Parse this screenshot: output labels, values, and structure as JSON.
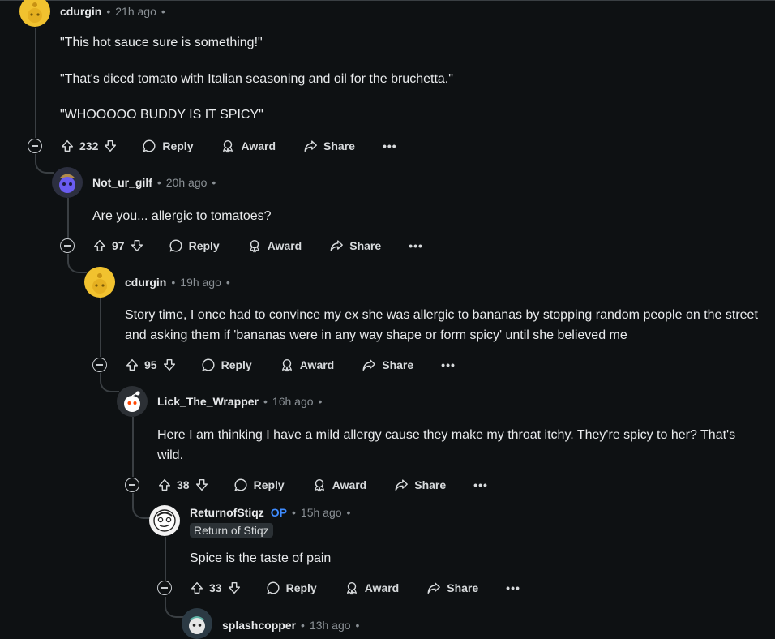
{
  "comments": [
    {
      "username": "cdurgin",
      "time": "21h ago",
      "paragraphs": [
        "\"This hot sauce sure is something!\"",
        "\"That's diced tomato with Italian seasoning and oil for the bruchetta.\"",
        "\"WHOOOOO BUDDY IS IT SPICY\""
      ],
      "votes": "232",
      "avatar": "snoo-avatar-yellow"
    },
    {
      "username": "Not_ur_gilf",
      "time": "20h ago",
      "paragraphs": [
        "Are you... allergic to tomatoes?"
      ],
      "votes": "97",
      "avatar": "snoo-avatar-purple"
    },
    {
      "username": "cdurgin",
      "time": "19h ago",
      "paragraphs": [
        "Story time, I once had to convince my ex she was allergic to bananas by stopping random people on the street and asking them if 'bananas were in any way shape or form spicy' until she believed me"
      ],
      "votes": "95",
      "avatar": "snoo-avatar-yellow"
    },
    {
      "username": "Lick_The_Wrapper",
      "time": "16h ago",
      "paragraphs": [
        "Here I am thinking I have a mild allergy cause they make my throat itchy. They're spicy to her? That's wild."
      ],
      "votes": "38",
      "avatar": "snoo-avatar-white"
    },
    {
      "username": "ReturnofStiqz",
      "op": "OP",
      "flair": "Return of Stiqz",
      "time": "15h ago",
      "paragraphs": [
        "Spice is the taste of pain"
      ],
      "votes": "33",
      "avatar": "sketch-avatar"
    },
    {
      "username": "splashcopper",
      "time": "13h ago",
      "avatar": "snoo-avatar-teal"
    }
  ],
  "actions": {
    "reply": "Reply",
    "award": "Award",
    "share": "Share",
    "more": "•••"
  },
  "separator": "•",
  "colors": {
    "background": "#0e1113",
    "thread_line": "#3a3f43",
    "op_badge": "#3f8cff",
    "avatar_yellow": "#f1c22f"
  }
}
